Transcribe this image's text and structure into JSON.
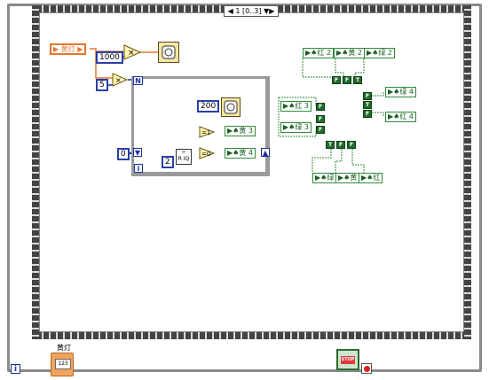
{
  "sequence": {
    "selector_label": "◀ 1 [0..3] ▼▶"
  },
  "nodes": {
    "light_ref": "▶ 黄灯 ▶",
    "const_1000": "1000",
    "const_5": "5",
    "const_200": "200",
    "const_0": "0",
    "const_2": "2",
    "for_count": "N",
    "for_index": "i",
    "loop_index": "i"
  },
  "property_nodes": {
    "ref_yellow_3": "▶♠黄 3",
    "ref_yellow_4": "▶♠黄 4",
    "ref_red_2": "▶♠红 2",
    "ref_yellow_2": "▶♠黄 2",
    "ref_green_2": "▶♠绿 2",
    "ref_red_3": "▶♠红 3",
    "ref_green_3": "▶♠绿 3",
    "ref_green_4": "▶♠绿 4",
    "ref_red_4": "▶♠红 4",
    "ref_green": "▶♠绿",
    "ref_yellow": "▶♠黄",
    "ref_red": "▶♠红"
  },
  "bool_consts": {
    "f_1": "F",
    "f_2": "F",
    "t_1": "T",
    "f_3": "F",
    "f_4": "F",
    "f_5": "F",
    "t_2": "T",
    "f_6": "F",
    "t_3": "T",
    "f_7": "F",
    "f_8": "F"
  },
  "controls": {
    "light_label": "黄灯",
    "light_value": "123",
    "stop_label": "STOP"
  },
  "colors": {
    "frame_gray": "#8a8a8a",
    "wire_orange": "#e6772f",
    "wire_blue": "#1c2fa0",
    "wire_green": "#2e8b3a"
  }
}
